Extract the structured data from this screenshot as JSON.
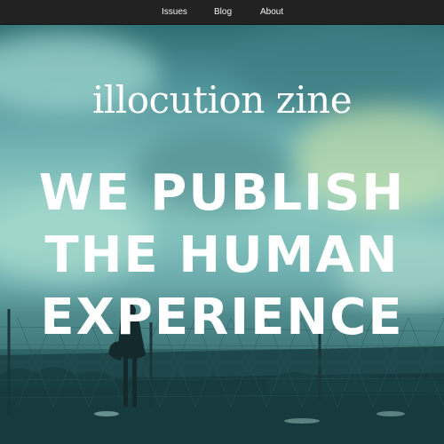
{
  "nav": {
    "items": [
      {
        "label": "Issues"
      },
      {
        "label": "Blog"
      },
      {
        "label": "About"
      }
    ]
  },
  "hero": {
    "logo": "illocution zine",
    "headline_lines": [
      "WE PUBLISH",
      "THE HUMAN",
      "EXPERIENCE"
    ]
  },
  "colors": {
    "nav_bg": "#222222",
    "nav_text": "#f2f2f2",
    "headline_text": "#ffffff",
    "sky_tint": "#6fb1b3"
  }
}
